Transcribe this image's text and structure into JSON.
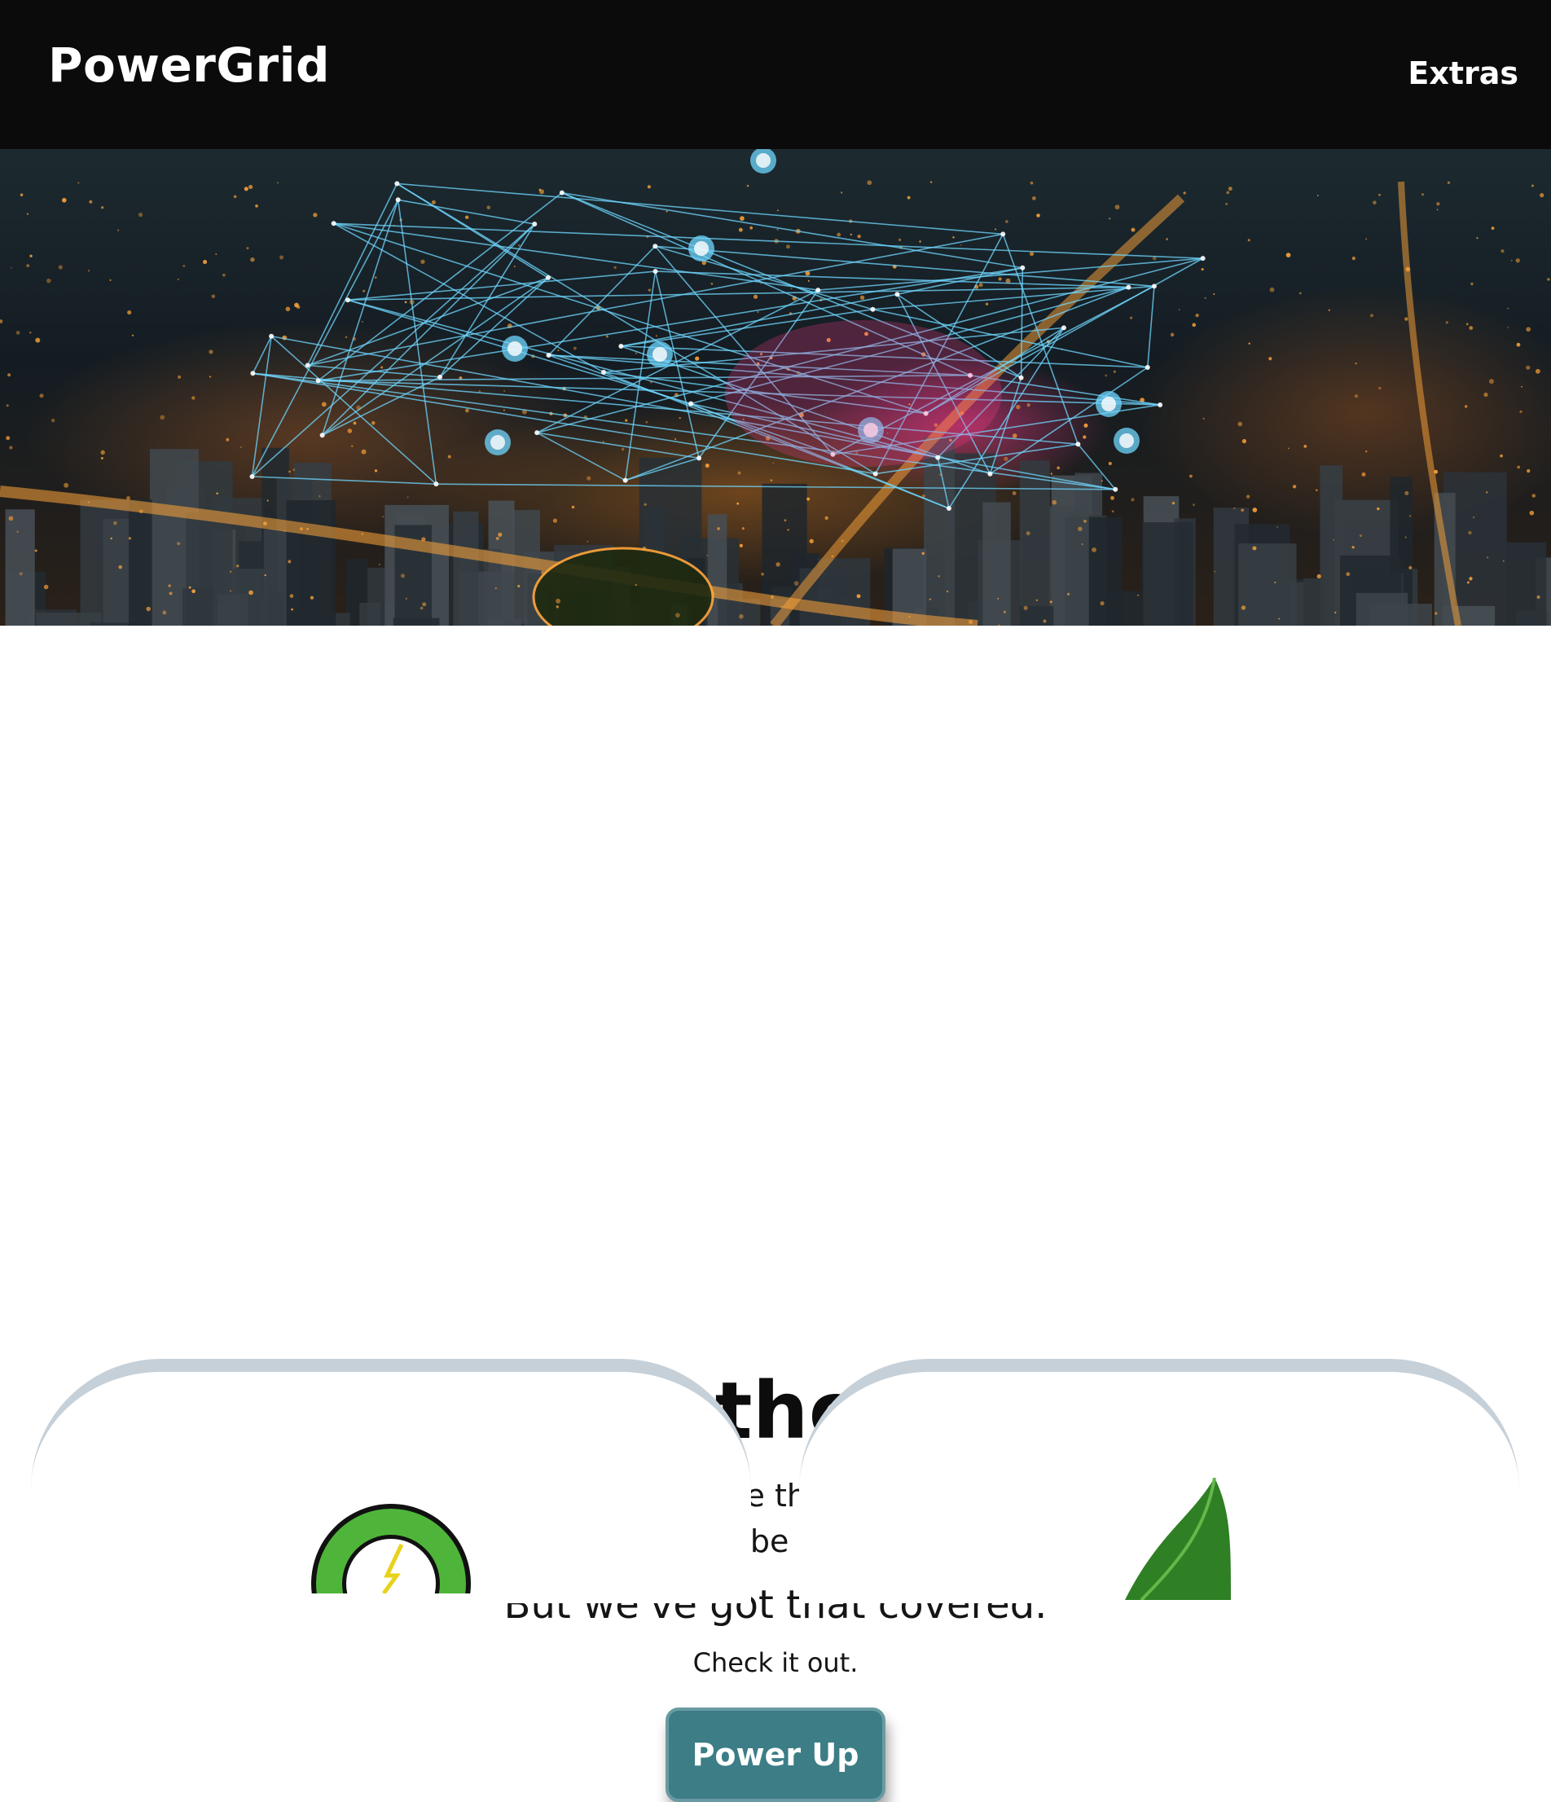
{
  "navbar": {
    "brand": "PowerGrid",
    "links": [
      {
        "label": "Extras"
      }
    ]
  },
  "hero": {
    "image": "night-city-power-grid-network",
    "colors": {
      "network_line": "#6fd7ff",
      "glow_pink": "#ff3c8c",
      "city_light": "#ffa53a"
    }
  },
  "intro": {
    "headline": "Welcome to the PowerGrid.",
    "lead": "Electric vehicles are the future. When you're this far ahead of the curve, finding a place to refuel can be a problem.",
    "tagline": "But we've got that covered.",
    "cta_text": "Check it out.",
    "cta_button": "Power Up"
  },
  "cards": [
    {
      "icon": "charging-plug-icon"
    },
    {
      "icon": "leaf-icon"
    }
  ],
  "colors": {
    "nav_bg": "#0b0b0b",
    "button_bg": "#3c7d86",
    "button_border": "#6a9aa3",
    "card_border": "#c6d0d8",
    "icon_green": "#3f9f2f"
  }
}
